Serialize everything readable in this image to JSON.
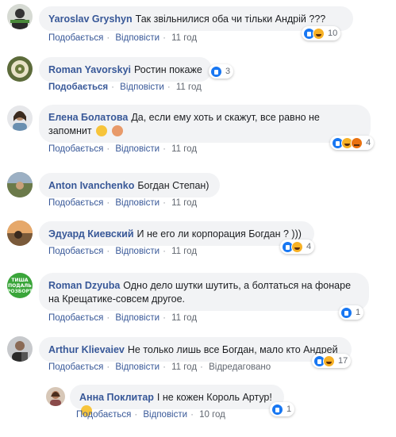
{
  "actions": {
    "like": "Подобається",
    "reply": "Відповісти",
    "edited": "Відредаговано"
  },
  "comments": [
    {
      "author": "Yaroslav Gryshyn",
      "text": "Так звільнилися оба чи тільки Андрій ???",
      "time": "11 год",
      "react_count": "10"
    },
    {
      "author": "Roman Yavorskyi",
      "text": "Ростин покаже",
      "time": "11 год",
      "react_count": "3"
    },
    {
      "author": "Елена Болатова",
      "text": "Да, если ему хоть и скажут, все равно не запомнит",
      "time": "11 год",
      "react_count": "4"
    },
    {
      "author": "Anton Ivanchenko",
      "text": "Богдан Степан)",
      "time": "11 год"
    },
    {
      "author": "Эдуард Киевский",
      "text": "И не его ли корпорация Богдан ? )))",
      "time": "11 год",
      "react_count": "4"
    },
    {
      "author": "Roman Dzyuba",
      "text": "Одно дело шутки шутить, а болтаться на фонаре на Крещатике-совсем другое.",
      "time": "11 год",
      "react_count": "1"
    },
    {
      "author": "Arthur Klievaiev",
      "text": "Не только лишь все Богдан, мало кто Андрей",
      "time": "11 год",
      "react_count": "17"
    },
    {
      "author": "Анна Поклитар",
      "text": "І не кожен Король Артур!",
      "time": "10 год",
      "react_count": "1"
    }
  ],
  "avatar_badge": {
    "line1": "ТИША",
    "line2": "ПОДАЛЬ",
    "line3": "РОЗБОРТ"
  }
}
